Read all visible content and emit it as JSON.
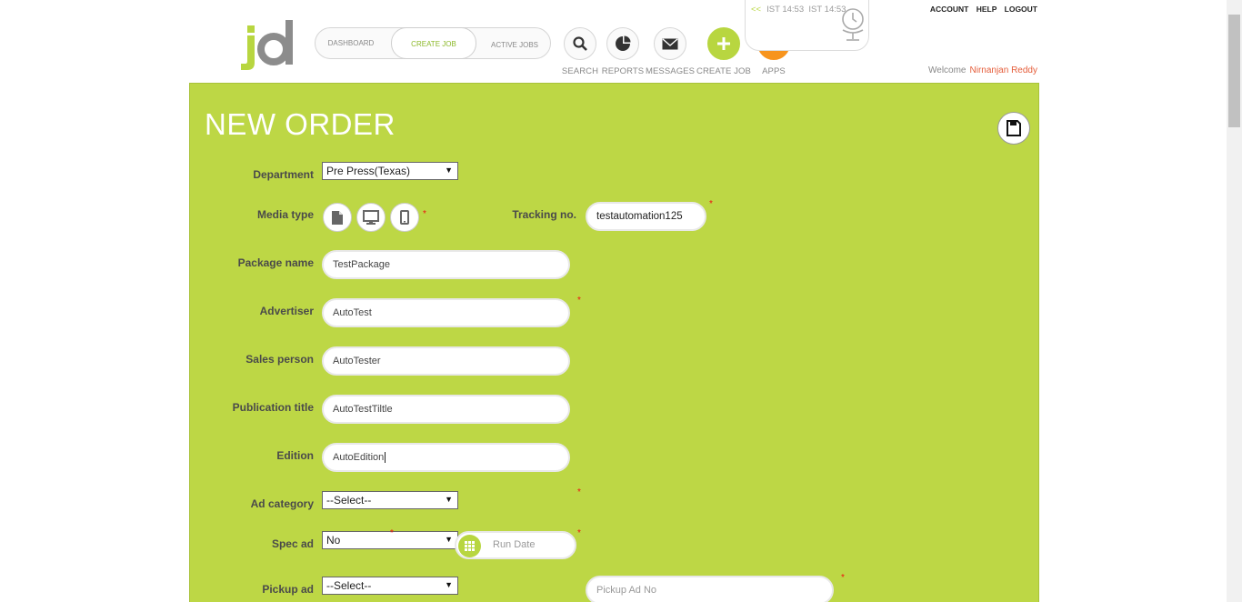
{
  "logo": {
    "text": "jd"
  },
  "nav_tabs": [
    {
      "label": "DASHBOARD"
    },
    {
      "label": "CREATE JOB"
    },
    {
      "label": "ACTIVE JOBS"
    }
  ],
  "tools": [
    {
      "label": "SEARCH",
      "icon": "search-icon"
    },
    {
      "label": "REPORTS",
      "icon": "pie-chart-icon"
    },
    {
      "label": "MESSAGES",
      "icon": "envelope-icon"
    },
    {
      "label": "CREATE JOB",
      "icon": "plus-icon"
    },
    {
      "label": "APPS",
      "icon": "grid-icon"
    }
  ],
  "clock": {
    "arrows": "<<",
    "time1": "IST 14:53",
    "time2": "IST 14:53"
  },
  "top_links": {
    "account": "ACCOUNT",
    "help": "HELP",
    "logout": "LOGOUT"
  },
  "welcome": {
    "text": "Welcome",
    "user": "Nirnanjan Reddy"
  },
  "form": {
    "title": "NEW ORDER",
    "department": {
      "label": "Department",
      "value": "Pre Press(Texas)"
    },
    "media_type": {
      "label": "Media type",
      "icons": [
        "document-icon",
        "monitor-icon",
        "mobile-icon"
      ]
    },
    "tracking_no": {
      "label": "Tracking no.",
      "value": "testautomation125"
    },
    "package_name": {
      "label": "Package name",
      "value": "TestPackage"
    },
    "advertiser": {
      "label": "Advertiser",
      "value": "AutoTest"
    },
    "sales_person": {
      "label": "Sales person",
      "value": "AutoTester"
    },
    "publication_title": {
      "label": "Publication title",
      "value": "AutoTestTiltle"
    },
    "edition": {
      "label": "Edition",
      "value": "AutoEdition"
    },
    "ad_category": {
      "label": "Ad category",
      "value": "--Select--"
    },
    "spec_ad": {
      "label": "Spec ad",
      "value": "No"
    },
    "run_date": {
      "placeholder": "Run Date"
    },
    "pickup_ad": {
      "label": "Pickup ad",
      "value": "--Select--"
    },
    "pickup_ad_no": {
      "placeholder": "Pickup Ad No"
    },
    "required_mark": "*"
  },
  "colors": {
    "accent_green": "#bdd745",
    "orange": "#f7941d",
    "user_name": "#e55d3a",
    "required": "#e11111"
  }
}
